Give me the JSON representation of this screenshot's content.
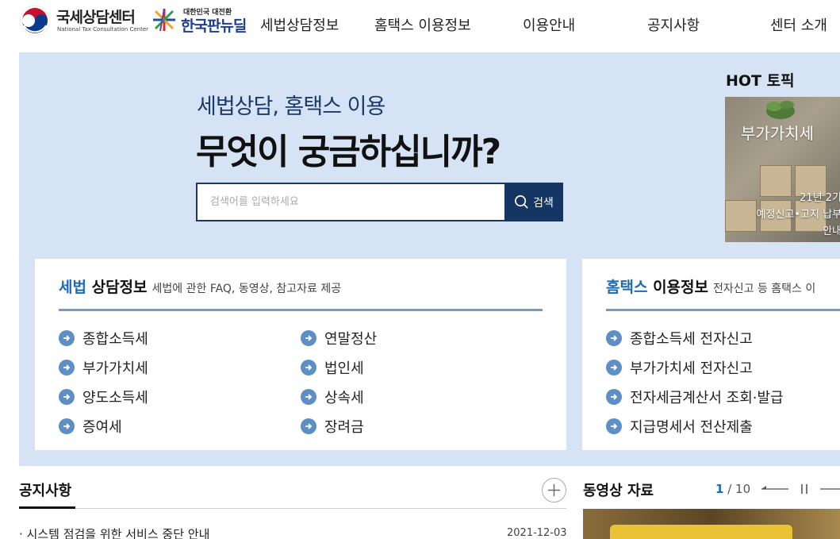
{
  "header": {
    "logo_kr": "국세상담센터",
    "logo_en": "National Tax Consultation Center",
    "newdeal_small": "대한민국 대전환",
    "newdeal_big": "한국판뉴딜",
    "nav": [
      "세법상담정보",
      "홈택스 이용정보",
      "이용안내",
      "공지사항",
      "센터 소개"
    ]
  },
  "hero": {
    "subtitle": "세법상담, 홈택스 이용",
    "title": "무엇이 궁금하십니까?",
    "search_placeholder": "검색어를 입력하세요",
    "search_button": "검색"
  },
  "hot": {
    "title": "HOT 토픽",
    "card_label": "부가가치세",
    "card_desc_1": "21년 2기",
    "card_desc_2": "예정신고•고지 납부",
    "card_desc_3": "안내"
  },
  "tax_card": {
    "title_highlight": "세법",
    "title_rest": " 상담정보",
    "description": "세법에 관한 FAQ, 동영상, 참고자료 제공",
    "items_left": [
      "종합소득세",
      "부가가치세",
      "양도소득세",
      "증여세"
    ],
    "items_right": [
      "연말정산",
      "법인세",
      "상속세",
      "장려금"
    ]
  },
  "hometax_card": {
    "title_highlight": "홈택스",
    "title_rest": " 이용정보",
    "description": "전자신고 등 홈택스 이",
    "items": [
      "종합소득세 전자신고",
      "부가가치세 전자신고",
      "전자세금계산서 조회·발급",
      "지급명세서 전산제출"
    ]
  },
  "notice": {
    "title": "공지사항",
    "row_text": "· 시스템 점검을 위한 서비스 중단 안내",
    "row_date": "2021-12-03"
  },
  "video": {
    "title": "동영상 자료",
    "page_current": "1",
    "page_total": " / 10"
  },
  "colors": {
    "hero_bg": "#d6e3f5",
    "navy": "#153562",
    "accent_blue": "#1d6bb5",
    "arrow_blue": "#5d8fc4"
  }
}
